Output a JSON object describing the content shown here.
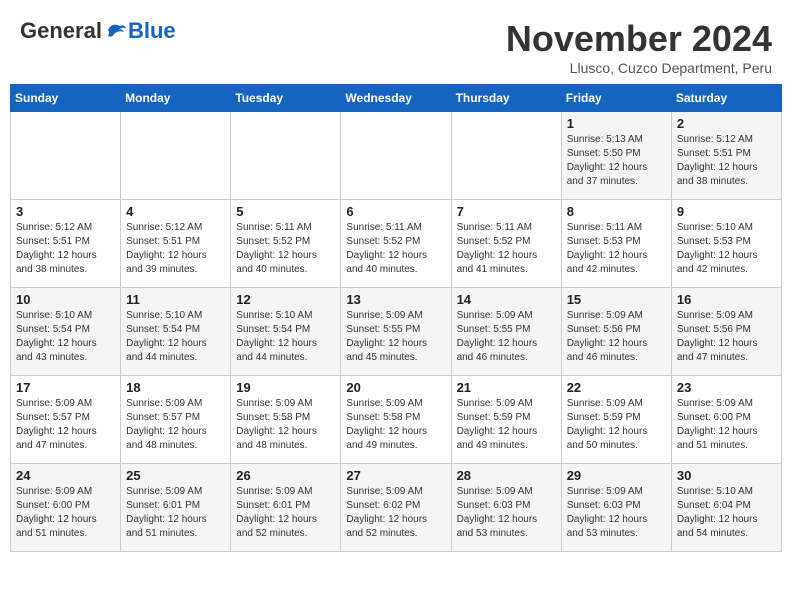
{
  "header": {
    "logo_general": "General",
    "logo_blue": "Blue",
    "month_year": "November 2024",
    "location": "Llusco, Cuzco Department, Peru"
  },
  "weekdays": [
    "Sunday",
    "Monday",
    "Tuesday",
    "Wednesday",
    "Thursday",
    "Friday",
    "Saturday"
  ],
  "weeks": [
    [
      {
        "day": "",
        "info": ""
      },
      {
        "day": "",
        "info": ""
      },
      {
        "day": "",
        "info": ""
      },
      {
        "day": "",
        "info": ""
      },
      {
        "day": "",
        "info": ""
      },
      {
        "day": "1",
        "info": "Sunrise: 5:13 AM\nSunset: 5:50 PM\nDaylight: 12 hours\nand 37 minutes."
      },
      {
        "day": "2",
        "info": "Sunrise: 5:12 AM\nSunset: 5:51 PM\nDaylight: 12 hours\nand 38 minutes."
      }
    ],
    [
      {
        "day": "3",
        "info": "Sunrise: 5:12 AM\nSunset: 5:51 PM\nDaylight: 12 hours\nand 38 minutes."
      },
      {
        "day": "4",
        "info": "Sunrise: 5:12 AM\nSunset: 5:51 PM\nDaylight: 12 hours\nand 39 minutes."
      },
      {
        "day": "5",
        "info": "Sunrise: 5:11 AM\nSunset: 5:52 PM\nDaylight: 12 hours\nand 40 minutes."
      },
      {
        "day": "6",
        "info": "Sunrise: 5:11 AM\nSunset: 5:52 PM\nDaylight: 12 hours\nand 40 minutes."
      },
      {
        "day": "7",
        "info": "Sunrise: 5:11 AM\nSunset: 5:52 PM\nDaylight: 12 hours\nand 41 minutes."
      },
      {
        "day": "8",
        "info": "Sunrise: 5:11 AM\nSunset: 5:53 PM\nDaylight: 12 hours\nand 42 minutes."
      },
      {
        "day": "9",
        "info": "Sunrise: 5:10 AM\nSunset: 5:53 PM\nDaylight: 12 hours\nand 42 minutes."
      }
    ],
    [
      {
        "day": "10",
        "info": "Sunrise: 5:10 AM\nSunset: 5:54 PM\nDaylight: 12 hours\nand 43 minutes."
      },
      {
        "day": "11",
        "info": "Sunrise: 5:10 AM\nSunset: 5:54 PM\nDaylight: 12 hours\nand 44 minutes."
      },
      {
        "day": "12",
        "info": "Sunrise: 5:10 AM\nSunset: 5:54 PM\nDaylight: 12 hours\nand 44 minutes."
      },
      {
        "day": "13",
        "info": "Sunrise: 5:09 AM\nSunset: 5:55 PM\nDaylight: 12 hours\nand 45 minutes."
      },
      {
        "day": "14",
        "info": "Sunrise: 5:09 AM\nSunset: 5:55 PM\nDaylight: 12 hours\nand 46 minutes."
      },
      {
        "day": "15",
        "info": "Sunrise: 5:09 AM\nSunset: 5:56 PM\nDaylight: 12 hours\nand 46 minutes."
      },
      {
        "day": "16",
        "info": "Sunrise: 5:09 AM\nSunset: 5:56 PM\nDaylight: 12 hours\nand 47 minutes."
      }
    ],
    [
      {
        "day": "17",
        "info": "Sunrise: 5:09 AM\nSunset: 5:57 PM\nDaylight: 12 hours\nand 47 minutes."
      },
      {
        "day": "18",
        "info": "Sunrise: 5:09 AM\nSunset: 5:57 PM\nDaylight: 12 hours\nand 48 minutes."
      },
      {
        "day": "19",
        "info": "Sunrise: 5:09 AM\nSunset: 5:58 PM\nDaylight: 12 hours\nand 48 minutes."
      },
      {
        "day": "20",
        "info": "Sunrise: 5:09 AM\nSunset: 5:58 PM\nDaylight: 12 hours\nand 49 minutes."
      },
      {
        "day": "21",
        "info": "Sunrise: 5:09 AM\nSunset: 5:59 PM\nDaylight: 12 hours\nand 49 minutes."
      },
      {
        "day": "22",
        "info": "Sunrise: 5:09 AM\nSunset: 5:59 PM\nDaylight: 12 hours\nand 50 minutes."
      },
      {
        "day": "23",
        "info": "Sunrise: 5:09 AM\nSunset: 6:00 PM\nDaylight: 12 hours\nand 51 minutes."
      }
    ],
    [
      {
        "day": "24",
        "info": "Sunrise: 5:09 AM\nSunset: 6:00 PM\nDaylight: 12 hours\nand 51 minutes."
      },
      {
        "day": "25",
        "info": "Sunrise: 5:09 AM\nSunset: 6:01 PM\nDaylight: 12 hours\nand 51 minutes."
      },
      {
        "day": "26",
        "info": "Sunrise: 5:09 AM\nSunset: 6:01 PM\nDaylight: 12 hours\nand 52 minutes."
      },
      {
        "day": "27",
        "info": "Sunrise: 5:09 AM\nSunset: 6:02 PM\nDaylight: 12 hours\nand 52 minutes."
      },
      {
        "day": "28",
        "info": "Sunrise: 5:09 AM\nSunset: 6:03 PM\nDaylight: 12 hours\nand 53 minutes."
      },
      {
        "day": "29",
        "info": "Sunrise: 5:09 AM\nSunset: 6:03 PM\nDaylight: 12 hours\nand 53 minutes."
      },
      {
        "day": "30",
        "info": "Sunrise: 5:10 AM\nSunset: 6:04 PM\nDaylight: 12 hours\nand 54 minutes."
      }
    ]
  ]
}
